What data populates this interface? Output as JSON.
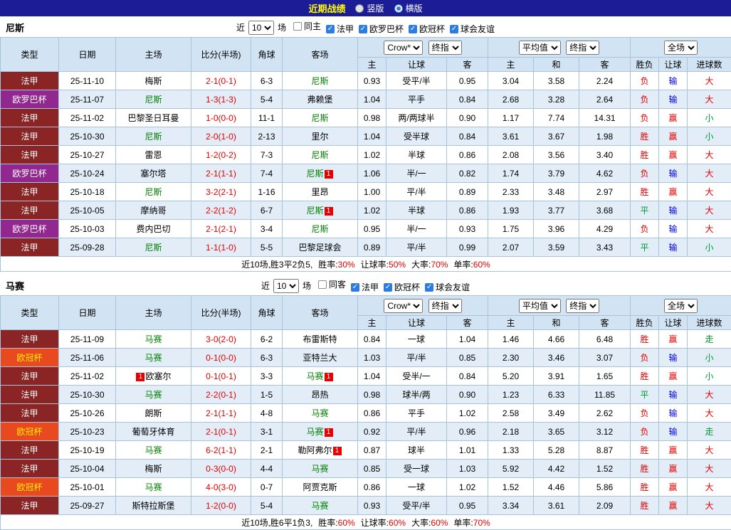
{
  "topbar": {
    "title": "近期战绩",
    "radios": [
      {
        "label": "竖版",
        "checked": false
      },
      {
        "label": "横版",
        "checked": true
      }
    ]
  },
  "colors": {
    "topbar_bg": "#1c1c96",
    "title_yellow": "#ffff00",
    "ligue1_badge": "#8b2424",
    "europa_badge": "#91278f",
    "ucl_badge": "#e8491f",
    "score_red": "#e60000",
    "team_green": "#008000",
    "loss_blue": "#0000e6",
    "draw_green": "#009933",
    "header_blue": "#d2e3f3",
    "stripe_blue": "#e2edf8"
  },
  "sections": [
    {
      "team": "尼斯",
      "filter": {
        "recent_label": "近",
        "count_value": "10",
        "games_label": "场",
        "checkboxes": [
          {
            "label": "同主",
            "checked": false
          },
          {
            "label": "法甲",
            "checked": true
          },
          {
            "label": "欧罗巴杯",
            "checked": true
          },
          {
            "label": "欧冠杯",
            "checked": true
          },
          {
            "label": "球会友谊",
            "checked": true
          }
        ]
      },
      "selects": {
        "odds_source": "Crow*",
        "odds_final": "终指",
        "avg_source": "平均值",
        "avg_final": "终指",
        "scope": "全场"
      },
      "header": {
        "static_cols": [
          "类型",
          "日期",
          "主场",
          "比分(半场)",
          "角球",
          "客场"
        ],
        "sub_cols": [
          "主",
          "让球",
          "客",
          "主",
          "和",
          "客",
          "胜负",
          "让球",
          "进球数"
        ]
      },
      "rows": [
        {
          "type": "法甲",
          "date": "25-11-10",
          "home": {
            "name": "梅斯",
            "self": false
          },
          "score": "2-1(0-1)",
          "corner": "6-3",
          "away": {
            "name": "尼斯",
            "self": true
          },
          "odds": [
            "0.93",
            "受平/半",
            "0.95"
          ],
          "avg": [
            "3.04",
            "3.58",
            "2.24"
          ],
          "result": [
            "负",
            "输",
            "大"
          ],
          "result_colors": [
            "red",
            "blue",
            "red"
          ]
        },
        {
          "type": "欧罗巴杯",
          "date": "25-11-07",
          "home": {
            "name": "尼斯",
            "self": true
          },
          "score": "1-3(1-3)",
          "corner": "5-4",
          "away": {
            "name": "弗赖堡",
            "self": false
          },
          "odds": [
            "1.04",
            "平手",
            "0.84"
          ],
          "avg": [
            "2.68",
            "3.28",
            "2.64"
          ],
          "result": [
            "负",
            "输",
            "大"
          ],
          "result_colors": [
            "red",
            "blue",
            "red"
          ]
        },
        {
          "type": "法甲",
          "date": "25-11-02",
          "home": {
            "name": "巴黎圣日耳曼",
            "self": false
          },
          "score": "1-0(0-0)",
          "corner": "11-1",
          "away": {
            "name": "尼斯",
            "self": true
          },
          "odds": [
            "0.98",
            "两/两球半",
            "0.90"
          ],
          "avg": [
            "1.17",
            "7.74",
            "14.31"
          ],
          "result": [
            "负",
            "赢",
            "小"
          ],
          "result_colors": [
            "red",
            "red",
            "green"
          ]
        },
        {
          "type": "法甲",
          "date": "25-10-30",
          "home": {
            "name": "尼斯",
            "self": true
          },
          "score": "2-0(1-0)",
          "corner": "2-13",
          "away": {
            "name": "里尔",
            "self": false
          },
          "odds": [
            "1.04",
            "受半球",
            "0.84"
          ],
          "avg": [
            "3.61",
            "3.67",
            "1.98"
          ],
          "result": [
            "胜",
            "赢",
            "小"
          ],
          "result_colors": [
            "red",
            "red",
            "green"
          ]
        },
        {
          "type": "法甲",
          "date": "25-10-27",
          "home": {
            "name": "雷恩",
            "self": false
          },
          "score": "1-2(0-2)",
          "corner": "7-3",
          "away": {
            "name": "尼斯",
            "self": true
          },
          "odds": [
            "1.02",
            "半球",
            "0.86"
          ],
          "avg": [
            "2.08",
            "3.56",
            "3.40"
          ],
          "result": [
            "胜",
            "赢",
            "大"
          ],
          "result_colors": [
            "red",
            "red",
            "red"
          ]
        },
        {
          "type": "欧罗巴杯",
          "date": "25-10-24",
          "home": {
            "name": "塞尔塔",
            "self": false
          },
          "score": "2-1(1-1)",
          "corner": "7-4",
          "away": {
            "name": "尼斯",
            "self": true,
            "badge": "1"
          },
          "odds": [
            "1.06",
            "半/一",
            "0.82"
          ],
          "avg": [
            "1.74",
            "3.79",
            "4.62"
          ],
          "result": [
            "负",
            "输",
            "大"
          ],
          "result_colors": [
            "red",
            "blue",
            "red"
          ]
        },
        {
          "type": "法甲",
          "date": "25-10-18",
          "home": {
            "name": "尼斯",
            "self": true
          },
          "score": "3-2(2-1)",
          "corner": "1-16",
          "away": {
            "name": "里昂",
            "self": false
          },
          "odds": [
            "1.00",
            "平/半",
            "0.89"
          ],
          "avg": [
            "2.33",
            "3.48",
            "2.97"
          ],
          "result": [
            "胜",
            "赢",
            "大"
          ],
          "result_colors": [
            "red",
            "red",
            "red"
          ]
        },
        {
          "type": "法甲",
          "date": "25-10-05",
          "home": {
            "name": "摩纳哥",
            "self": false
          },
          "score": "2-2(1-2)",
          "corner": "6-7",
          "away": {
            "name": "尼斯",
            "self": true,
            "badge": "1"
          },
          "odds": [
            "1.02",
            "半球",
            "0.86"
          ],
          "avg": [
            "1.93",
            "3.77",
            "3.68"
          ],
          "result": [
            "平",
            "输",
            "大"
          ],
          "result_colors": [
            "green",
            "blue",
            "red"
          ]
        },
        {
          "type": "欧罗巴杯",
          "date": "25-10-03",
          "home": {
            "name": "费内巴切",
            "self": false
          },
          "score": "2-1(2-1)",
          "corner": "3-4",
          "away": {
            "name": "尼斯",
            "self": true
          },
          "odds": [
            "0.95",
            "半/一",
            "0.93"
          ],
          "avg": [
            "1.75",
            "3.96",
            "4.29"
          ],
          "result": [
            "负",
            "输",
            "大"
          ],
          "result_colors": [
            "red",
            "blue",
            "red"
          ]
        },
        {
          "type": "法甲",
          "date": "25-09-28",
          "home": {
            "name": "尼斯",
            "self": true
          },
          "score": "1-1(1-0)",
          "corner": "5-5",
          "away": {
            "name": "巴黎足球会",
            "self": false
          },
          "odds": [
            "0.89",
            "平/半",
            "0.99"
          ],
          "avg": [
            "2.07",
            "3.59",
            "3.43"
          ],
          "result": [
            "平",
            "输",
            "小"
          ],
          "result_colors": [
            "green",
            "blue",
            "green"
          ]
        }
      ],
      "summary": {
        "prefix": "近10场,胜3平2负5,",
        "stats": [
          {
            "label": "胜率:",
            "value": "30%"
          },
          {
            "label": "让球率:",
            "value": "50%"
          },
          {
            "label": "大率:",
            "value": "70%"
          },
          {
            "label": "单率:",
            "value": "60%"
          }
        ]
      }
    },
    {
      "team": "马赛",
      "filter": {
        "recent_label": "近",
        "count_value": "10",
        "games_label": "场",
        "checkboxes": [
          {
            "label": "同客",
            "checked": false
          },
          {
            "label": "法甲",
            "checked": true
          },
          {
            "label": "欧冠杯",
            "checked": true
          },
          {
            "label": "球会友谊",
            "checked": true
          }
        ]
      },
      "selects": {
        "odds_source": "Crow*",
        "odds_final": "终指",
        "avg_source": "平均值",
        "avg_final": "终指",
        "scope": "全场"
      },
      "header": {
        "static_cols": [
          "类型",
          "日期",
          "主场",
          "比分(半场)",
          "角球",
          "客场"
        ],
        "sub_cols": [
          "主",
          "让球",
          "客",
          "主",
          "和",
          "客",
          "胜负",
          "让球",
          "进球数"
        ]
      },
      "rows": [
        {
          "type": "法甲",
          "date": "25-11-09",
          "home": {
            "name": "马赛",
            "self": true
          },
          "score": "3-0(2-0)",
          "corner": "6-2",
          "away": {
            "name": "布雷斯特",
            "self": false
          },
          "odds": [
            "0.84",
            "一球",
            "1.04"
          ],
          "avg": [
            "1.46",
            "4.66",
            "6.48"
          ],
          "result": [
            "胜",
            "赢",
            "走"
          ],
          "result_colors": [
            "red",
            "red",
            "green"
          ]
        },
        {
          "type": "欧冠杯",
          "date": "25-11-06",
          "home": {
            "name": "马赛",
            "self": true
          },
          "score": "0-1(0-0)",
          "corner": "6-3",
          "away": {
            "name": "亚特兰大",
            "self": false
          },
          "odds": [
            "1.03",
            "平/半",
            "0.85"
          ],
          "avg": [
            "2.30",
            "3.46",
            "3.07"
          ],
          "result": [
            "负",
            "输",
            "小"
          ],
          "result_colors": [
            "red",
            "blue",
            "green"
          ]
        },
        {
          "type": "法甲",
          "date": "25-11-02",
          "home": {
            "name": "欧塞尔",
            "self": false,
            "badge_pre": "1"
          },
          "score": "0-1(0-1)",
          "corner": "3-3",
          "away": {
            "name": "马赛",
            "self": true,
            "badge": "1"
          },
          "odds": [
            "1.04",
            "受半/一",
            "0.84"
          ],
          "avg": [
            "5.20",
            "3.91",
            "1.65"
          ],
          "result": [
            "胜",
            "赢",
            "小"
          ],
          "result_colors": [
            "red",
            "red",
            "green"
          ]
        },
        {
          "type": "法甲",
          "date": "25-10-30",
          "home": {
            "name": "马赛",
            "self": true
          },
          "score": "2-2(0-1)",
          "corner": "1-5",
          "away": {
            "name": "昂热",
            "self": false
          },
          "odds": [
            "0.98",
            "球半/两",
            "0.90"
          ],
          "avg": [
            "1.23",
            "6.33",
            "11.85"
          ],
          "result": [
            "平",
            "输",
            "大"
          ],
          "result_colors": [
            "green",
            "blue",
            "red"
          ]
        },
        {
          "type": "法甲",
          "date": "25-10-26",
          "home": {
            "name": "朗斯",
            "self": false
          },
          "score": "2-1(1-1)",
          "corner": "4-8",
          "away": {
            "name": "马赛",
            "self": true
          },
          "odds": [
            "0.86",
            "平手",
            "1.02"
          ],
          "avg": [
            "2.58",
            "3.49",
            "2.62"
          ],
          "result": [
            "负",
            "输",
            "大"
          ],
          "result_colors": [
            "red",
            "blue",
            "red"
          ]
        },
        {
          "type": "欧冠杯",
          "date": "25-10-23",
          "home": {
            "name": "葡萄牙体育",
            "self": false
          },
          "score": "2-1(0-1)",
          "corner": "3-1",
          "away": {
            "name": "马赛",
            "self": true,
            "badge": "1"
          },
          "odds": [
            "0.92",
            "平/半",
            "0.96"
          ],
          "avg": [
            "2.18",
            "3.65",
            "3.12"
          ],
          "result": [
            "负",
            "输",
            "走"
          ],
          "result_colors": [
            "red",
            "blue",
            "green"
          ]
        },
        {
          "type": "法甲",
          "date": "25-10-19",
          "home": {
            "name": "马赛",
            "self": true
          },
          "score": "6-2(1-1)",
          "corner": "2-1",
          "away": {
            "name": "勒阿弗尔",
            "self": false,
            "badge": "1"
          },
          "odds": [
            "0.87",
            "球半",
            "1.01"
          ],
          "avg": [
            "1.33",
            "5.28",
            "8.87"
          ],
          "result": [
            "胜",
            "赢",
            "大"
          ],
          "result_colors": [
            "red",
            "red",
            "red"
          ]
        },
        {
          "type": "法甲",
          "date": "25-10-04",
          "home": {
            "name": "梅斯",
            "self": false
          },
          "score": "0-3(0-0)",
          "corner": "4-4",
          "away": {
            "name": "马赛",
            "self": true
          },
          "odds": [
            "0.85",
            "受一球",
            "1.03"
          ],
          "avg": [
            "5.92",
            "4.42",
            "1.52"
          ],
          "result": [
            "胜",
            "赢",
            "大"
          ],
          "result_colors": [
            "red",
            "red",
            "red"
          ]
        },
        {
          "type": "欧冠杯",
          "date": "25-10-01",
          "home": {
            "name": "马赛",
            "self": true
          },
          "score": "4-0(3-0)",
          "corner": "0-7",
          "away": {
            "name": "阿贾克斯",
            "self": false
          },
          "odds": [
            "0.86",
            "一球",
            "1.02"
          ],
          "avg": [
            "1.52",
            "4.46",
            "5.86"
          ],
          "result": [
            "胜",
            "赢",
            "大"
          ],
          "result_colors": [
            "red",
            "red",
            "red"
          ]
        },
        {
          "type": "法甲",
          "date": "25-09-27",
          "home": {
            "name": "斯特拉斯堡",
            "self": false
          },
          "score": "1-2(0-0)",
          "corner": "5-4",
          "away": {
            "name": "马赛",
            "self": true
          },
          "odds": [
            "0.93",
            "受平/半",
            "0.95"
          ],
          "avg": [
            "3.34",
            "3.61",
            "2.09"
          ],
          "result": [
            "胜",
            "赢",
            "大"
          ],
          "result_colors": [
            "red",
            "red",
            "red"
          ]
        }
      ],
      "summary": {
        "prefix": "近10场,胜6平1负3,",
        "stats": [
          {
            "label": "胜率:",
            "value": "60%"
          },
          {
            "label": "让球率:",
            "value": "60%"
          },
          {
            "label": "大率:",
            "value": "60%"
          },
          {
            "label": "单率:",
            "value": "70%"
          }
        ]
      }
    }
  ]
}
